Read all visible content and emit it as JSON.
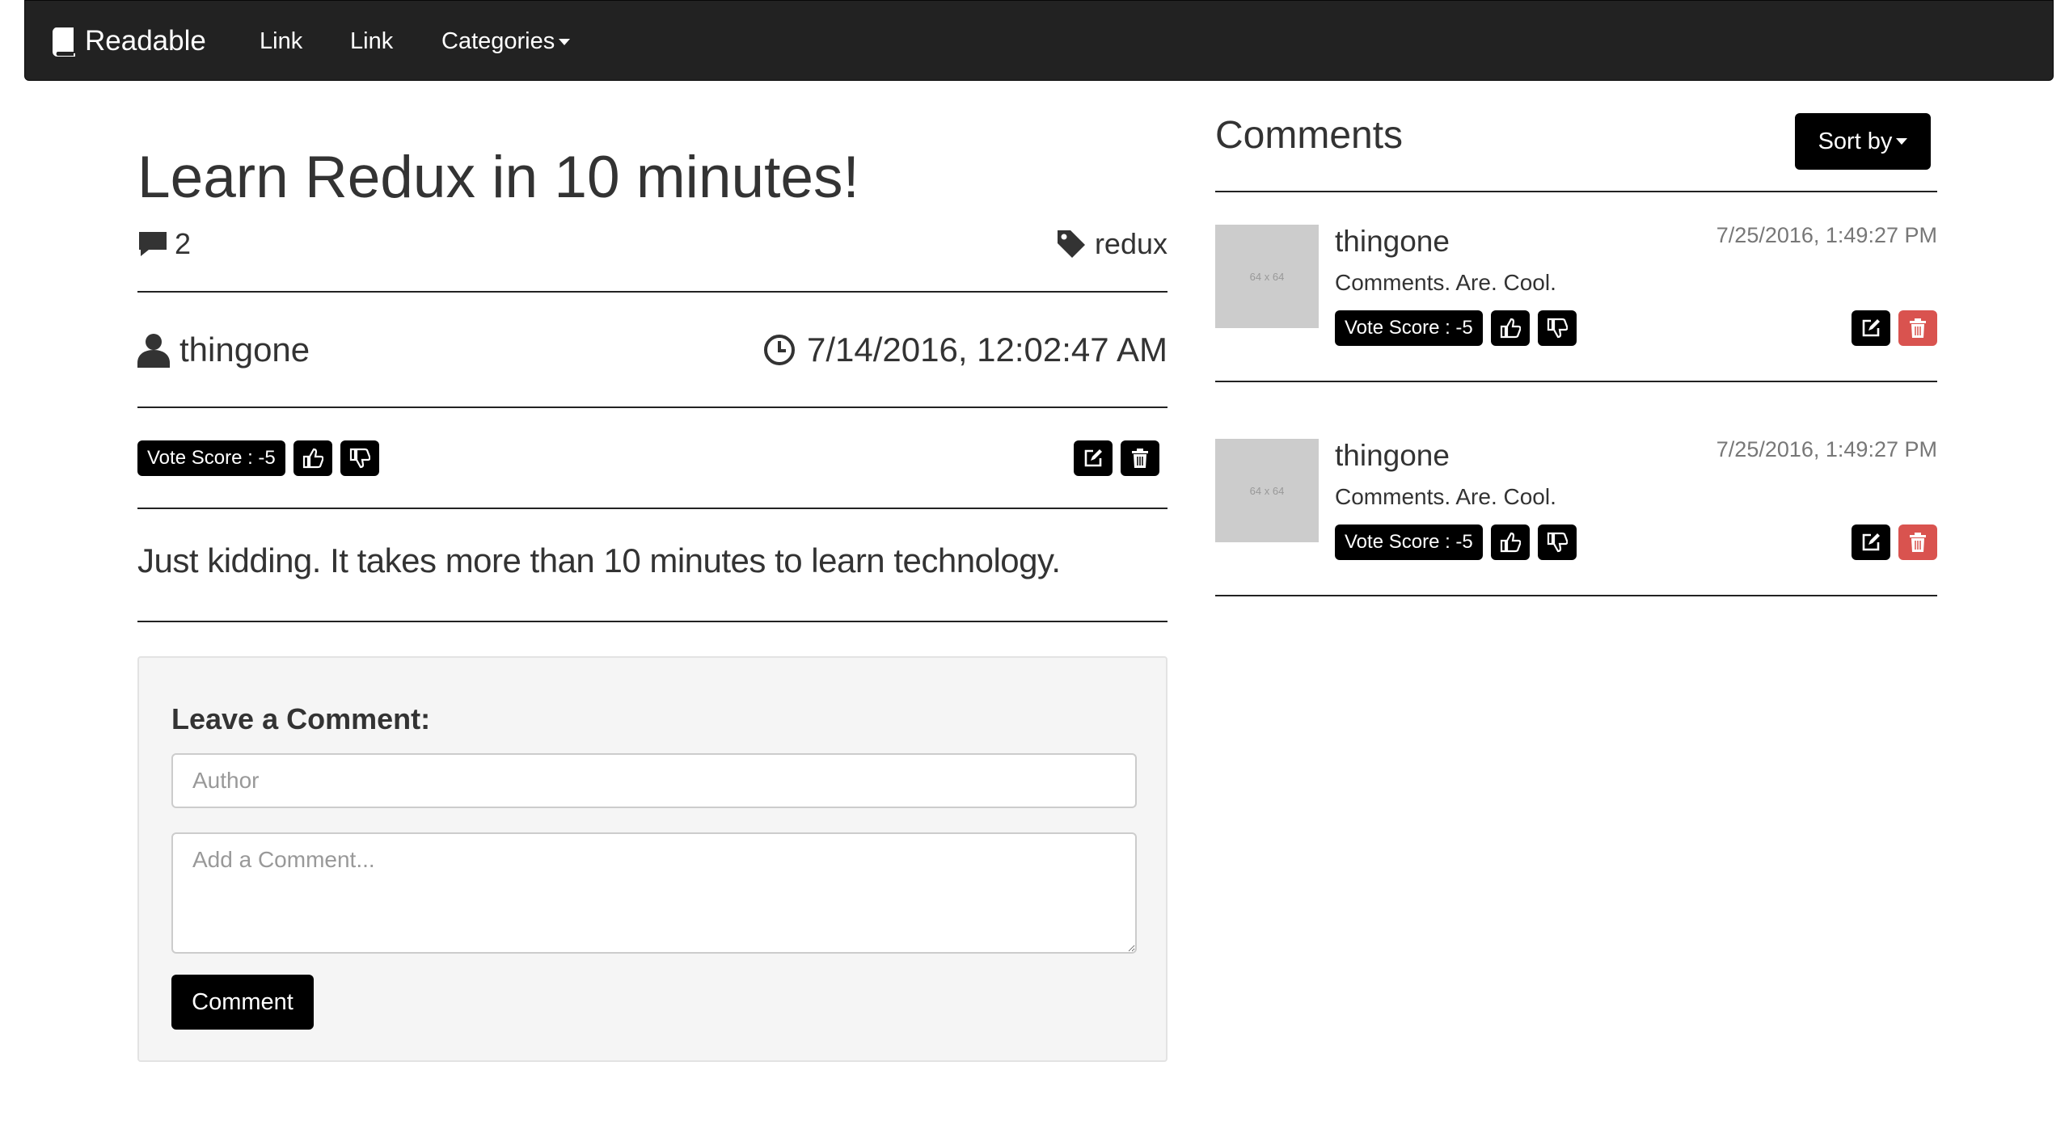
{
  "nav": {
    "brand": "Readable",
    "links": [
      "Link",
      "Link"
    ],
    "categories_label": "Categories"
  },
  "post": {
    "title": "Learn Redux in 10 minutes!",
    "comment_count": "2",
    "category": "redux",
    "author": "thingone",
    "timestamp": "7/14/2016, 12:02:47 AM",
    "vote_score": "Vote Score : -5",
    "body": "Just kidding. It takes more than 10 minutes to learn technology."
  },
  "form": {
    "label": "Leave a Comment:",
    "author_placeholder": "Author",
    "comment_placeholder": "Add a Comment...",
    "submit_label": "Comment"
  },
  "comments_panel": {
    "title": "Comments",
    "sort_label": "Sort by",
    "items": [
      {
        "thumb_text": "64 x 64",
        "author": "thingone",
        "timestamp": "7/25/2016, 1:49:27 PM",
        "body": "Comments. Are. Cool.",
        "vote_score": "Vote Score : -5"
      },
      {
        "thumb_text": "64 x 64",
        "author": "thingone",
        "timestamp": "7/25/2016, 1:49:27 PM",
        "body": "Comments. Are. Cool.",
        "vote_score": "Vote Score : -5"
      }
    ]
  },
  "colors": {
    "navbar_bg": "#222222",
    "button_black": "#000000",
    "danger_red": "#d9534f",
    "thumb_gray": "#cccccc",
    "well_bg": "#f5f5f5"
  }
}
